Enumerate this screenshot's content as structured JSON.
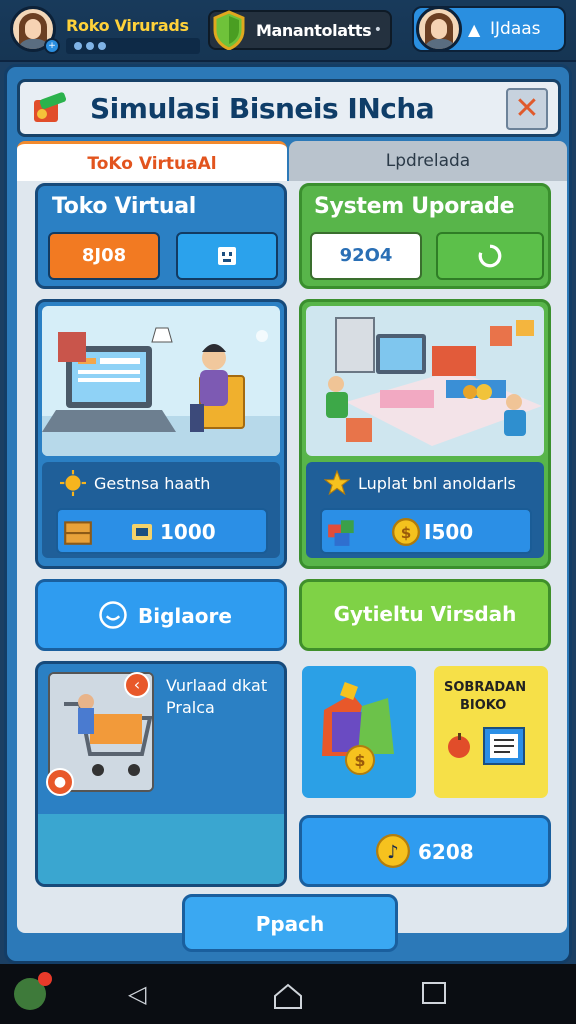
{
  "header": {
    "profile_name": "Roko Virurads",
    "status_label": "Manantolatts",
    "status_menu": "•",
    "user_label": "IJdaas"
  },
  "panel": {
    "title": "Simulasi Bisneis INcha",
    "close_symbol": "✕"
  },
  "tabs": [
    {
      "label": "ToKo VirtuaAl"
    },
    {
      "label": "Lpdrelada"
    }
  ],
  "left_card": {
    "heading": "Toko Virtual",
    "value": "8J08",
    "info": "Gestnsa haath",
    "price": "1000"
  },
  "right_card": {
    "heading": "System Uporade",
    "value": "92O4",
    "info": "Luplat bnl anoldarls",
    "price": "I500"
  },
  "buttons": {
    "left_action": "Biglaore",
    "right_action": "Gytieltu Virsdah",
    "bottom_value": "6208",
    "bottom_main": "Ppach"
  },
  "promo": {
    "text_line1": "Vurlaad dkat",
    "text_line2": "Pralca"
  },
  "yellow_card": {
    "line1": "SOBRADAN",
    "line2": "BIOKO"
  },
  "colors": {
    "accent_orange": "#f27a22",
    "accent_blue": "#2b8fe6",
    "accent_green": "#58b54a",
    "panel_blue": "#2c79b8"
  }
}
